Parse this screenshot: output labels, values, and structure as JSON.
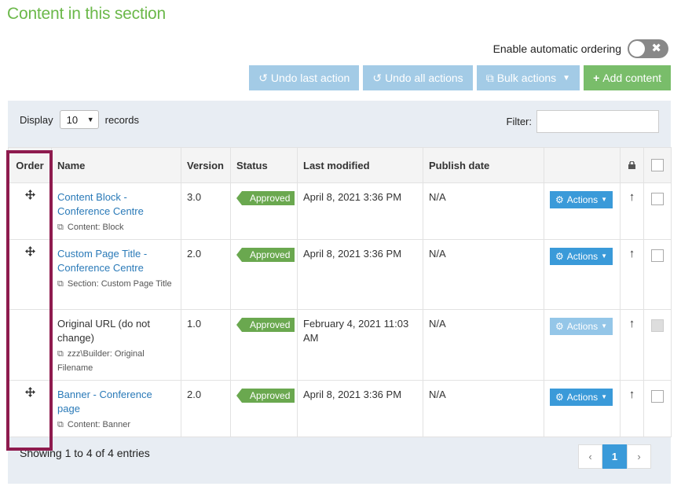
{
  "title": "Content in this section",
  "auto_ordering": {
    "label": "Enable automatic ordering",
    "enabled": false,
    "off_glyph": "✖"
  },
  "toolbar": {
    "undo_last": "Undo last action",
    "undo_all": "Undo all actions",
    "bulk": "Bulk actions",
    "add": "Add content"
  },
  "display": {
    "prefix": "Display",
    "value": "10",
    "suffix": "records"
  },
  "filter": {
    "label": "Filter:",
    "value": ""
  },
  "columns": {
    "order": "Order",
    "name": "Name",
    "version": "Version",
    "status": "Status",
    "modified": "Last modified",
    "publish": "Publish date"
  },
  "rows": [
    {
      "name": "Content Block - Conference Centre",
      "linked": true,
      "type": "Content: Block",
      "version": "3.0",
      "status": "Approved",
      "modified": "April 8, 2021 3:36 PM",
      "publish": "N/A",
      "actions": "Actions"
    },
    {
      "name": "Custom Page Title - Conference Centre",
      "linked": true,
      "type": "Section: Custom Page Title",
      "version": "2.0",
      "status": "Approved",
      "modified": "April 8, 2021 3:36 PM",
      "publish": "N/A",
      "actions": "Actions"
    },
    {
      "name": "Original URL (do not change)",
      "linked": false,
      "type": "zzz\\Builder: Original Filename",
      "version": "1.0",
      "status": "Approved",
      "modified": "February 4, 2021 11:03 AM",
      "publish": "N/A",
      "actions": "Actions"
    },
    {
      "name": "Banner - Conference page",
      "linked": true,
      "type": "Content: Banner",
      "version": "2.0",
      "status": "Approved",
      "modified": "April 8, 2021 3:36 PM",
      "publish": "N/A",
      "actions": "Actions"
    }
  ],
  "footer": {
    "showing": "Showing 1 to 4 of 4 entries",
    "page": "1",
    "prev": "‹",
    "next": "›"
  },
  "colors": {
    "accent": "#3a9ad9",
    "approved": "#6aa84f",
    "title": "#6bb84a",
    "highlight": "#8e1b4e"
  }
}
